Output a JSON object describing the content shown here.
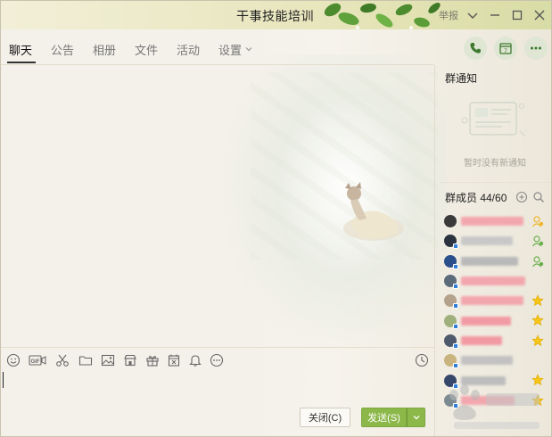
{
  "window": {
    "title": "干事技能培训",
    "report_label": "举报"
  },
  "tabs": [
    {
      "label": "聊天",
      "active": true
    },
    {
      "label": "公告",
      "active": false
    },
    {
      "label": "相册",
      "active": false
    },
    {
      "label": "文件",
      "active": false
    },
    {
      "label": "活动",
      "active": false
    },
    {
      "label": "设置",
      "active": false
    }
  ],
  "header_actions": {
    "call_icon": "phone-icon",
    "calendar_icon": "calendar-icon",
    "calendar_day": "7",
    "more_icon": "more-icon"
  },
  "notice": {
    "title": "群通知",
    "empty_text": "暂时没有新通知"
  },
  "members": {
    "title": "群成员 44/60",
    "list": [
      {
        "avatar_color": "#3a3a3a",
        "name_color": "#f2a6ad",
        "badge": "owner-icon"
      },
      {
        "avatar_color": "#2c3340",
        "name_color": "#c8c8c8",
        "badge": "admin-icon"
      },
      {
        "avatar_color": "#2a4f8a",
        "name_color": "#b9b9b9",
        "badge": "admin-icon"
      },
      {
        "avatar_color": "#5b6b7a",
        "name_color": "#f2a6ad",
        "badge": ""
      },
      {
        "avatar_color": "#b4a28c",
        "name_color": "#f2a6ad",
        "badge": "star-icon"
      },
      {
        "avatar_color": "#9fb07c",
        "name_color": "#f29aa3",
        "badge": "star-icon"
      },
      {
        "avatar_color": "#4f5a6d",
        "name_color": "#f29aa3",
        "badge": "star-icon"
      },
      {
        "avatar_color": "#c9b37e",
        "name_color": "#c2c2c2",
        "badge": ""
      },
      {
        "avatar_color": "#36476a",
        "name_color": "#bdbdbd",
        "badge": "star-icon"
      },
      {
        "avatar_color": "#7c8a92",
        "name_color": "#f2a6ad",
        "badge": "star-icon"
      }
    ]
  },
  "toolbar": {
    "tools": [
      "emoji-icon",
      "gif-icon",
      "scissors-icon",
      "folder-icon",
      "image-icon",
      "shop-icon",
      "gift-icon",
      "calendar-x-icon",
      "bell-icon",
      "more-circle-icon"
    ],
    "history_icon": "clock-icon"
  },
  "composer": {
    "value": "",
    "close_label": "关闭(C)",
    "send_label": "发送(S)"
  },
  "colors": {
    "send_green": "#8cb84a",
    "background": "#f3efe6"
  }
}
